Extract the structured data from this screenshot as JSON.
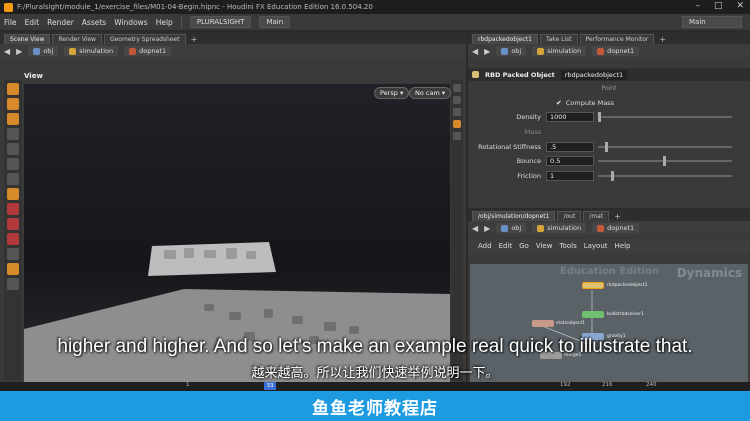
{
  "window": {
    "title": "F:/Pluralsight/module_1/exercise_files/M01-04-Begin.hipnc - Houdini FX Education Edition 16.0.504.20",
    "controls": [
      "–",
      "□",
      "✕"
    ]
  },
  "menubar": {
    "items": [
      "File",
      "Edit",
      "Render",
      "Assets",
      "Windows",
      "Help"
    ],
    "shelf": "PLURALSIGHT",
    "desktop_left": "Main",
    "desktop_right": "Main"
  },
  "left_pane": {
    "tabs": [
      "Scene View",
      "Render View",
      "Geometry Spreadsheet"
    ],
    "path": [
      "obj",
      "simulation",
      "dopnet1"
    ],
    "view_label": "View",
    "persp": "Persp ▾",
    "cam": "No cam ▾"
  },
  "param_pane": {
    "tabs": [
      "rbdpackedobject1",
      "Take List",
      "Performance Monitor"
    ],
    "path": [
      "obj",
      "simulation",
      "dopnet1"
    ],
    "node_type": "RBD Packed Object",
    "node_name": "rbdpackedobject1",
    "section": "Point",
    "compute_mass": "Compute Mass",
    "params": [
      {
        "label": "Density",
        "value": "1000",
        "knob": 0.0
      },
      {
        "label": "Mass",
        "value": "",
        "knob": null,
        "dim": true
      },
      {
        "label": "Rotational Stiffness",
        "value": ".5",
        "knob": 0.05
      },
      {
        "label": "Bounce",
        "value": "0.5",
        "knob": 0.5
      },
      {
        "label": "Friction",
        "value": "1",
        "knob": 0.1
      }
    ]
  },
  "network_pane": {
    "tabs": [
      "/obj/simulation/dopnet1",
      "/out",
      "/mat"
    ],
    "path": [
      "obj",
      "simulation",
      "dopnet1"
    ],
    "menu": [
      "Add",
      "Edit",
      "Go",
      "View",
      "Tools",
      "Layout",
      "Help"
    ],
    "watermark_edu": "Education Edition",
    "watermark_context": "Dynamics",
    "nodes": [
      "rbdpackedobject1",
      "bulletrbdsolver1",
      "staticobject1",
      "gravity1",
      "merge1"
    ]
  },
  "timeline": {
    "frame": "33",
    "ticks": [
      "1",
      "192",
      "216",
      "240"
    ]
  },
  "subtitles": {
    "en": "higher and higher. And so let's make an example real quick to illustrate that.",
    "zh": "越来越高。所以让我们快速举例说明一下。"
  },
  "banner": "鱼鱼老师教程店"
}
